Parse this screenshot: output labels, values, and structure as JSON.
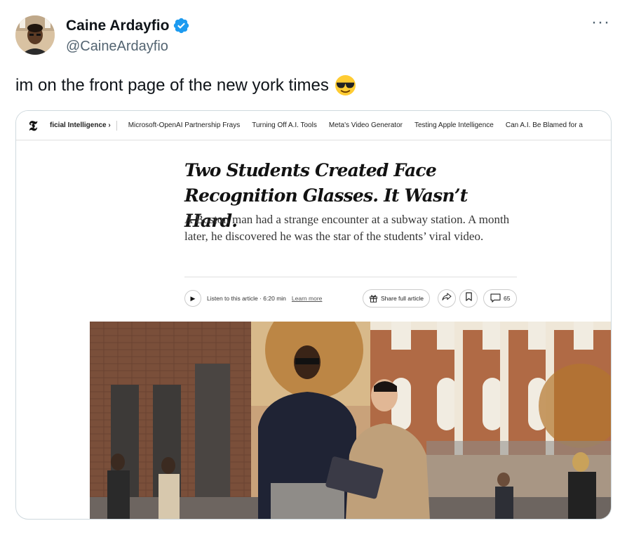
{
  "author": {
    "display_name": "Caine Ardayfio",
    "handle": "@CaineArdayfio",
    "verified": true,
    "verified_icon": "verified-badge-icon"
  },
  "more_icon": "more-horizontal-icon",
  "tweet": {
    "text": "im on the front page of the new york times",
    "emoji": "smiling-face-with-sunglasses"
  },
  "article": {
    "nav": {
      "logo": "𝕿",
      "items": [
        "ficial Intelligence ›",
        "Microsoft-OpenAI Partnership Frays",
        "Turning Off A.I. Tools",
        "Meta's Video Generator",
        "Testing Apple Intelligence",
        "Can A.I. Be Blamed for a"
      ]
    },
    "headline": "Two Students Created Face Recognition Glasses. It Wasn’t Hard.",
    "summary": "A Boston man had a strange encounter at a subway station. A month later, he discovered he was the star of the students’ viral video.",
    "listen_label": "Listen to this article · 6:20 min",
    "learn_more": "Learn more",
    "share_full": "Share full article",
    "comments_count": "65"
  },
  "colors": {
    "accent": "#1d9bf0",
    "text_primary": "#0f1419",
    "text_secondary": "#536471",
    "border": "#cfd9de"
  }
}
